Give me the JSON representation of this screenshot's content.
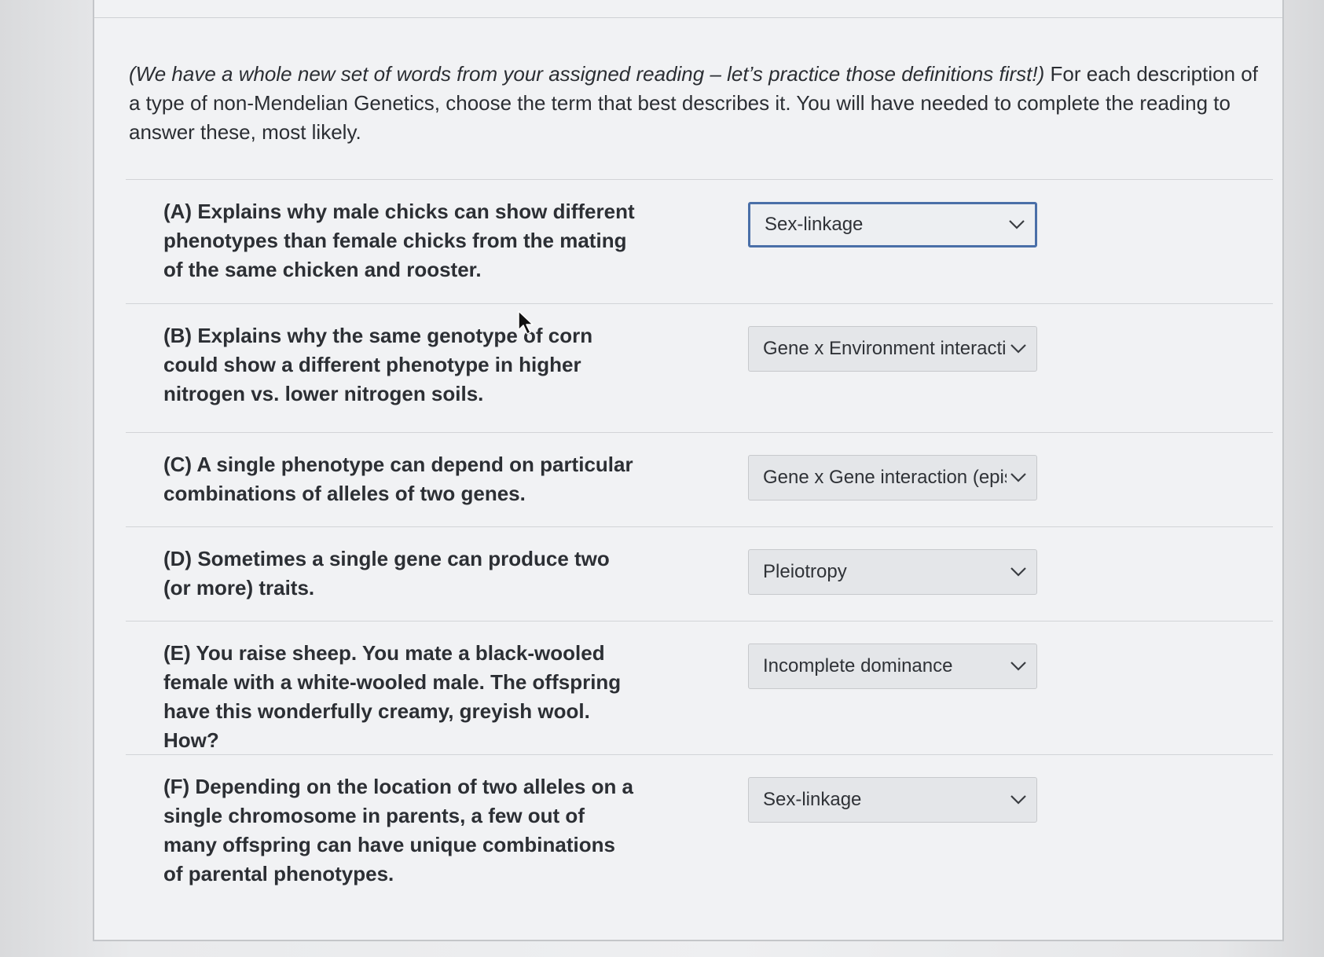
{
  "intro": {
    "italic_part": "(We have a whole new set of words from your assigned reading – let’s practice those definitions first!)",
    "rest": " For each description of a type of non-Mendelian Genetics, choose the term that best describes it. You will have needed to complete the reading to answer these, most likely."
  },
  "questions": [
    {
      "text": "(A) Explains why male chicks can show different phenotypes than female chicks from the mating of the same chicken and rooster.",
      "selected": "Sex-linkage"
    },
    {
      "text": "(B) Explains why the same genotype of corn could show a different phenotype in higher nitrogen vs. lower nitrogen soils.",
      "selected": "Gene x Environment interacti"
    },
    {
      "text": "(C) A single phenotype can depend on particular combinations of alleles of two genes.",
      "selected": "Gene x Gene interaction (epis"
    },
    {
      "text": "(D) Sometimes a single gene can produce two (or more) traits.",
      "selected": "Pleiotropy"
    },
    {
      "text": "(E) You raise sheep. You mate a black-wooled female with a white-wooled male. The offspring have this wonderfully creamy, greyish wool. How?",
      "selected": "Incomplete dominance"
    },
    {
      "text": "(F) Depending on the location of two alleles on a single chromosome in parents, a few out of many offspring can have unique combinations of parental phenotypes.",
      "selected": "Sex-linkage"
    }
  ],
  "icons": {
    "dropdown": "chevron-down-icon",
    "cursor": "mouse-pointer-icon"
  },
  "colors": {
    "focus_border": "#4a6fa8",
    "select_bg": "#e4e6e9"
  }
}
